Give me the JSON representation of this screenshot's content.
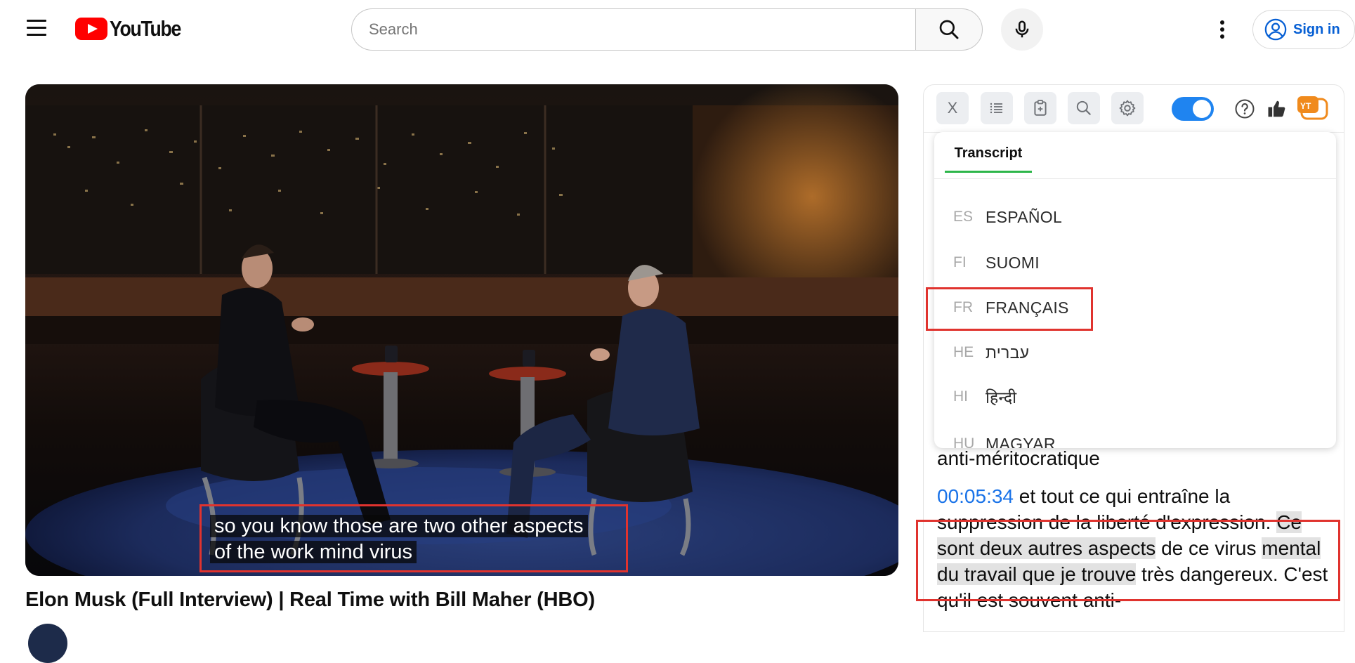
{
  "header": {
    "logo_text": "YouTube",
    "search_placeholder": "Search",
    "sign_in_label": "Sign in"
  },
  "video": {
    "title": "Elon Musk (Full Interview) | Real Time with Bill Maher (HBO)",
    "captions": [
      "so you know those are two other aspects",
      "of the work mind virus"
    ]
  },
  "extension": {
    "toolbar": {
      "close_label": "X",
      "toggle_on": true
    },
    "tab_label": "Transcript",
    "languages": [
      {
        "code": "ES",
        "name": "ESPAÑOL"
      },
      {
        "code": "FI",
        "name": "SUOMI"
      },
      {
        "code": "FR",
        "name": "FRANÇAIS"
      },
      {
        "code": "HE",
        "name": "עברית"
      },
      {
        "code": "HI",
        "name": "हिन्दी"
      },
      {
        "code": "HU",
        "name": "MAGYAR"
      }
    ],
    "transcript": {
      "prev_line": "anti-méritocratique",
      "timestamp": "00:05:34",
      "seg_a": " et tout ce qui entraîne la suppression de la liberté d'expression. ",
      "seg_b": "Ce sont deux autres aspects",
      "seg_c": " de ce virus ",
      "seg_d": "mental du travail que je trouve",
      "seg_e": " très dangereux. C'est qu'il est souvent anti-"
    }
  },
  "colors": {
    "youtube_red": "#ff0000",
    "highlight_box": "#e0332e",
    "link_blue": "#065fd4",
    "timestamp_blue": "#1a73e8",
    "toggle_blue": "#1f84f0",
    "tab_underline": "#2db64a"
  },
  "icons": [
    "menu-icon",
    "search-icon",
    "mic-icon",
    "more-vert-icon",
    "account-icon",
    "list-icon",
    "copy-icon",
    "search-icon",
    "settings-icon",
    "help-icon",
    "thumbs-up-icon",
    "ytai-icon"
  ]
}
